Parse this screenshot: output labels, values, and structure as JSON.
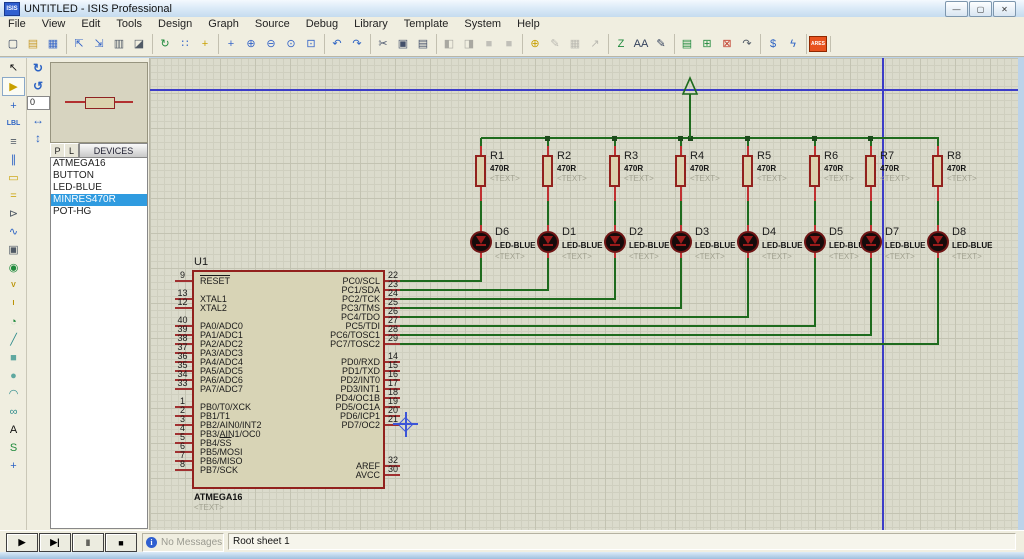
{
  "window": {
    "title": "UNTITLED - ISIS Professional",
    "icon_text": "ISIS",
    "controls": [
      {
        "name": "minimize-button",
        "glyph": "—"
      },
      {
        "name": "maximize-button",
        "glyph": "▢"
      },
      {
        "name": "close-button",
        "glyph": "✕"
      }
    ]
  },
  "menu_bar": {
    "items": [
      "File",
      "View",
      "Edit",
      "Tools",
      "Design",
      "Graph",
      "Source",
      "Debug",
      "Library",
      "Template",
      "System",
      "Help"
    ]
  },
  "toolbar": {
    "groups": [
      [
        {
          "name": "new-file-icon",
          "glyph": "▢",
          "color": "#33415c"
        },
        {
          "name": "open-design-icon",
          "glyph": "▤",
          "color": "#c89b2a"
        },
        {
          "name": "save-design-icon",
          "glyph": "▦",
          "color": "#3565c8"
        }
      ],
      [
        {
          "name": "import-section-icon",
          "glyph": "⇱",
          "color": "#3565c8"
        },
        {
          "name": "export-section-icon",
          "glyph": "⇲",
          "color": "#3565c8"
        },
        {
          "name": "print-design-icon",
          "glyph": "▥",
          "color": "#505a66"
        },
        {
          "name": "mark-output-area-icon",
          "glyph": "◪",
          "color": "#505a66"
        }
      ],
      [
        {
          "name": "refresh-display-icon",
          "glyph": "↻",
          "color": "#1f8a3c"
        },
        {
          "name": "toggle-grid-icon",
          "glyph": "∷",
          "color": "#3565c8"
        },
        {
          "name": "false-origin-icon",
          "glyph": "+",
          "color": "#c8a000"
        }
      ],
      [
        {
          "name": "center-at-cursor-icon",
          "glyph": "+",
          "color": "#3565c8"
        },
        {
          "name": "zoom-in-icon",
          "glyph": "⊕",
          "color": "#3565c8"
        },
        {
          "name": "zoom-out-icon",
          "glyph": "⊖",
          "color": "#3565c8"
        },
        {
          "name": "zoom-all-icon",
          "glyph": "⊙",
          "color": "#3565c8"
        },
        {
          "name": "zoom-area-icon",
          "glyph": "⊡",
          "color": "#3565c8"
        }
      ],
      [
        {
          "name": "undo-icon",
          "glyph": "↶",
          "color": "#2c63c4"
        },
        {
          "name": "redo-icon",
          "glyph": "↷",
          "color": "#2c63c4"
        }
      ],
      [
        {
          "name": "cut-icon",
          "glyph": "✂",
          "color": "#44506a"
        },
        {
          "name": "copy-icon",
          "glyph": "▣",
          "color": "#44506a"
        },
        {
          "name": "paste-icon",
          "glyph": "▤",
          "color": "#44506a"
        }
      ],
      [
        {
          "name": "block-copy-icon",
          "glyph": "◧",
          "color": "#555",
          "disabled": true
        },
        {
          "name": "block-move-icon",
          "glyph": "◨",
          "color": "#555",
          "disabled": true
        },
        {
          "name": "block-rotate-icon",
          "glyph": "■",
          "color": "#888",
          "disabled": true
        },
        {
          "name": "block-delete-icon",
          "glyph": "■",
          "color": "#888",
          "disabled": true
        }
      ],
      [
        {
          "name": "pick-part-icon",
          "glyph": "⊕",
          "color": "#c8a000"
        },
        {
          "name": "make-device-icon",
          "glyph": "✎",
          "color": "#777",
          "disabled": true
        },
        {
          "name": "packaging-tool-icon",
          "glyph": "▦",
          "color": "#777",
          "disabled": true
        },
        {
          "name": "decompose-icon",
          "glyph": "↗",
          "color": "#777",
          "disabled": true
        }
      ],
      [
        {
          "name": "wire-autorouter-icon",
          "glyph": "Z",
          "color": "#1f8a3c"
        },
        {
          "name": "search-tag-icon",
          "glyph": "AA",
          "color": "#33415c"
        },
        {
          "name": "property-assignment-icon",
          "glyph": "✎",
          "color": "#33415c"
        }
      ],
      [
        {
          "name": "design-explorer-icon",
          "glyph": "▤",
          "color": "#1f8a3c"
        },
        {
          "name": "new-sheet-icon",
          "glyph": "⊞",
          "color": "#1f8a3c"
        },
        {
          "name": "remove-sheet-icon",
          "glyph": "⊠",
          "color": "#c23b2a"
        },
        {
          "name": "goto-sheet-icon",
          "glyph": "↷",
          "color": "#505a66"
        }
      ],
      [
        {
          "name": "bill-of-materials-icon",
          "glyph": "$",
          "color": "#2c63c4"
        },
        {
          "name": "electrical-rule-check-icon",
          "glyph": "ϟ",
          "color": "#2c63c4"
        }
      ],
      [
        {
          "name": "netlist-to-ares-icon",
          "glyph": "ARES",
          "color": "#fff",
          "badge": true
        }
      ]
    ]
  },
  "mode_toolbar": {
    "items": [
      {
        "name": "selection-mode-icon",
        "glyph": "↖",
        "color": "#111"
      },
      {
        "name": "component-mode-icon",
        "glyph": "▶",
        "color": "#c8a000",
        "selected": true
      },
      {
        "name": "junction-dot-mode-icon",
        "glyph": "+",
        "color": "#2c63c4"
      },
      {
        "name": "wire-label-mode-icon",
        "glyph": "LBL",
        "color": "#2c63c4",
        "small": true
      },
      {
        "name": "text-script-mode-icon",
        "glyph": "≡",
        "color": "#505a66"
      },
      {
        "name": "buses-mode-icon",
        "glyph": "∥",
        "color": "#2c63c4"
      },
      {
        "name": "subcircuit-mode-icon",
        "glyph": "▭",
        "color": "#c8a000"
      },
      {
        "name": "terminals-mode-icon",
        "glyph": "=",
        "color": "#c8a000"
      },
      {
        "name": "device-pins-mode-icon",
        "glyph": "⊳",
        "color": "#505a66"
      },
      {
        "name": "graph-mode-icon",
        "glyph": "∿",
        "color": "#2c63c4"
      },
      {
        "name": "tape-recorder-mode-icon",
        "glyph": "▣",
        "color": "#505a66"
      },
      {
        "name": "generator-mode-icon",
        "glyph": "◉",
        "color": "#1f8a3c"
      },
      {
        "name": "voltage-probe-mode-icon",
        "glyph": "V",
        "color": "#b89000",
        "small": true
      },
      {
        "name": "current-probe-mode-icon",
        "glyph": "I",
        "color": "#b89000",
        "small": true
      },
      {
        "name": "virtual-instruments-mode-icon",
        "glyph": "◔",
        "color": "#1f8a3c"
      },
      {
        "name": "graphics-line-mode-icon",
        "glyph": "╱",
        "color": "#2e8b8b"
      },
      {
        "name": "graphics-box-mode-icon",
        "glyph": "■",
        "color": "#5fa8a0"
      },
      {
        "name": "graphics-circle-mode-icon",
        "glyph": "●",
        "color": "#5fa8a0"
      },
      {
        "name": "graphics-arc-mode-icon",
        "glyph": "◠",
        "color": "#2e8b8b"
      },
      {
        "name": "graphics-path-mode-icon",
        "glyph": "∞",
        "color": "#2e8b8b"
      },
      {
        "name": "graphics-text-mode-icon",
        "glyph": "A",
        "color": "#111"
      },
      {
        "name": "graphics-symbol-mode-icon",
        "glyph": "S",
        "color": "#1f8a3c"
      },
      {
        "name": "graphics-marker-mode-icon",
        "glyph": "+",
        "color": "#2c63c4"
      }
    ]
  },
  "orientation_toolbar": {
    "rotate_cw_glyph": "↻",
    "rotate_ccw_glyph": "↺",
    "angle_value": "0",
    "mirror_h_glyph": "↔",
    "mirror_v_glyph": "↕"
  },
  "object_selector": {
    "pick_button": "P",
    "library_button": "L",
    "header": "DEVICES",
    "devices": [
      "ATMEGA16",
      "BUTTON",
      "LED-BLUE",
      "MINRES470R",
      "POT-HG"
    ],
    "selected_device": "MINRES470R"
  },
  "schematic": {
    "columns": [
      {
        "resistor_ref": "R1",
        "resistor_value": "470R",
        "led_ref": "D6",
        "led_value": "LED-BLUE",
        "placeholder": "<TEXT>"
      },
      {
        "resistor_ref": "R2",
        "resistor_value": "470R",
        "led_ref": "D1",
        "led_value": "LED-BLUE",
        "placeholder": "<TEXT>"
      },
      {
        "resistor_ref": "R3",
        "resistor_value": "470R",
        "led_ref": "D2",
        "led_value": "LED-BLUE",
        "placeholder": "<TEXT>"
      },
      {
        "resistor_ref": "R4",
        "resistor_value": "470R",
        "led_ref": "D3",
        "led_value": "LED-BLUE",
        "placeholder": "<TEXT>"
      },
      {
        "resistor_ref": "R5",
        "resistor_value": "470R",
        "led_ref": "D4",
        "led_value": "LED-BLUE",
        "placeholder": "<TEXT>"
      },
      {
        "resistor_ref": "R6",
        "resistor_value": "470R",
        "led_ref": "D5",
        "led_value": "LED-BLUE",
        "placeholder": "<TEXT>"
      },
      {
        "resistor_ref": "R7",
        "resistor_value": "470R",
        "led_ref": "D7",
        "led_value": "LED-BLUE",
        "placeholder": "<TEXT>"
      },
      {
        "resistor_ref": "R8",
        "resistor_value": "470R",
        "led_ref": "D8",
        "led_value": "LED-BLUE",
        "placeholder": "<TEXT>"
      }
    ],
    "chip": {
      "ref": "U1",
      "value": "ATMEGA16",
      "placeholder": "<TEXT>",
      "left_pins": [
        {
          "num": "9",
          "name": "RESET",
          "bar": "RESET"
        },
        {
          "num": "13",
          "name": "XTAL1"
        },
        {
          "num": "12",
          "name": "XTAL2"
        },
        {
          "num": "40",
          "name": "PA0/ADC0"
        },
        {
          "num": "39",
          "name": "PA1/ADC1"
        },
        {
          "num": "38",
          "name": "PA2/ADC2"
        },
        {
          "num": "37",
          "name": "PA3/ADC3"
        },
        {
          "num": "36",
          "name": "PA4/ADC4"
        },
        {
          "num": "35",
          "name": "PA5/ADC5"
        },
        {
          "num": "34",
          "name": "PA6/ADC6"
        },
        {
          "num": "33",
          "name": "PA7/ADC7"
        },
        {
          "num": "1",
          "name": "PB0/T0/XCK"
        },
        {
          "num": "2",
          "name": "PB1/T1"
        },
        {
          "num": "3",
          "name": "PB2/AIN0/INT2"
        },
        {
          "num": "4",
          "name": "PB3/AIN1/OC0"
        },
        {
          "num": "5",
          "name": "PB4/SS",
          "bar": "SS"
        },
        {
          "num": "6",
          "name": "PB5/MOSI"
        },
        {
          "num": "7",
          "name": "PB6/MISO"
        },
        {
          "num": "8",
          "name": "PB7/SCK"
        }
      ],
      "right_pins": [
        {
          "num": "22",
          "name": "PC0/SCL"
        },
        {
          "num": "23",
          "name": "PC1/SDA"
        },
        {
          "num": "24",
          "name": "PC2/TCK"
        },
        {
          "num": "25",
          "name": "PC3/TMS"
        },
        {
          "num": "26",
          "name": "PC4/TDO"
        },
        {
          "num": "27",
          "name": "PC5/TDI"
        },
        {
          "num": "28",
          "name": "PC6/TOSC1"
        },
        {
          "num": "29",
          "name": "PC7/TOSC2"
        },
        {
          "num": "14",
          "name": "PD0/RXD"
        },
        {
          "num": "15",
          "name": "PD1/TXD"
        },
        {
          "num": "16",
          "name": "PD2/INT0"
        },
        {
          "num": "17",
          "name": "PD3/INT1"
        },
        {
          "num": "18",
          "name": "PD4/OC1B"
        },
        {
          "num": "19",
          "name": "PD5/OC1A"
        },
        {
          "num": "20",
          "name": "PD6/ICP1"
        },
        {
          "num": "21",
          "name": "PD7/OC2"
        },
        {
          "num": "32",
          "name": "AREF"
        },
        {
          "num": "30",
          "name": "AVCC"
        }
      ]
    }
  },
  "status_bar": {
    "playback": [
      {
        "name": "play-button",
        "glyph": "▶"
      },
      {
        "name": "step-button",
        "glyph": "▶|"
      },
      {
        "name": "pause-button",
        "glyph": "‖"
      },
      {
        "name": "stop-button",
        "glyph": "■"
      }
    ],
    "message": "No Messages",
    "message_icon": "i",
    "sheet_label": "Root sheet 1"
  },
  "colors": {
    "wire_green": "#1e6b1e",
    "pin_red": "#bf3030",
    "component_outline": "#92211d",
    "component_fill": "#dcd3ae",
    "selection_blue": "#2f9be0",
    "sheet_border_blue": "#3c3cc8"
  }
}
